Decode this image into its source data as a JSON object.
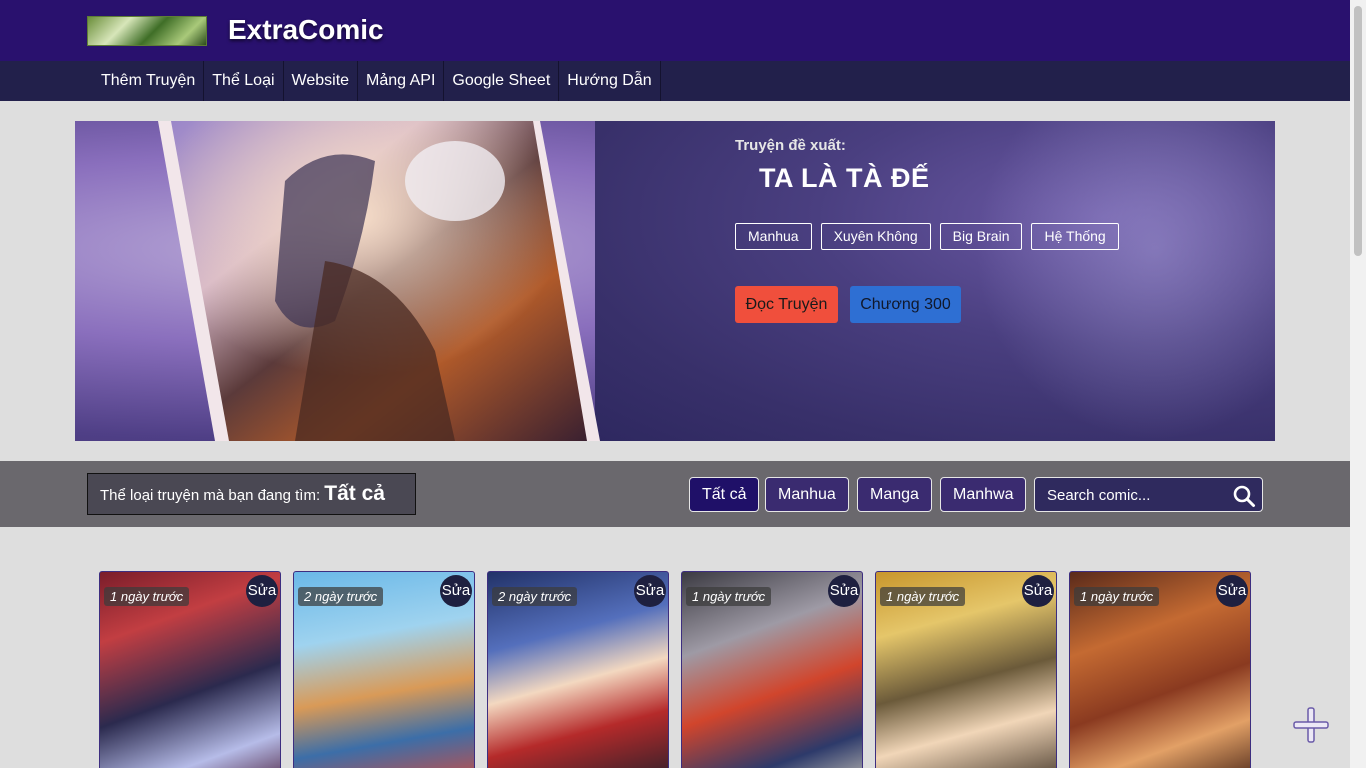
{
  "header": {
    "brand": "ExtraComic"
  },
  "nav": {
    "items": [
      {
        "label": "Thêm Truyện"
      },
      {
        "label": "Thể Loại"
      },
      {
        "label": "Website"
      },
      {
        "label": "Mảng API"
      },
      {
        "label": "Google Sheet"
      },
      {
        "label": "Hướng Dẫn"
      }
    ]
  },
  "featured": {
    "label": "Truyện đề xuất:",
    "title": "TA LÀ TÀ ĐẾ",
    "tags": [
      "Manhua",
      "Xuyên Không",
      "Big Brain",
      "Hệ Thống"
    ],
    "read_button": "Đọc Truyện",
    "chapter_button": "Chương 300"
  },
  "filter": {
    "prompt": "Thể loại truyện mà bạn đang tìm:",
    "current": "Tất cả",
    "buttons": [
      "Tất cả",
      "Manhua",
      "Manga",
      "Manhwa"
    ],
    "search_placeholder": "Search comic..."
  },
  "comics": [
    {
      "time": "1 ngày trước",
      "edit": "Sửa"
    },
    {
      "time": "2 ngày trước",
      "edit": "Sửa"
    },
    {
      "time": "2 ngày trước",
      "edit": "Sửa"
    },
    {
      "time": "1 ngày trước",
      "edit": "Sửa"
    },
    {
      "time": "1 ngày trước",
      "edit": "Sửa"
    },
    {
      "time": "1 ngày trước",
      "edit": "Sửa"
    }
  ],
  "colors": {
    "header_bg": "#29116e",
    "nav_bg": "#22204b",
    "read_button": "#f04f3c",
    "chapter_button": "#2e6fd3"
  },
  "icons": [
    "search-icon",
    "plus-icon"
  ]
}
